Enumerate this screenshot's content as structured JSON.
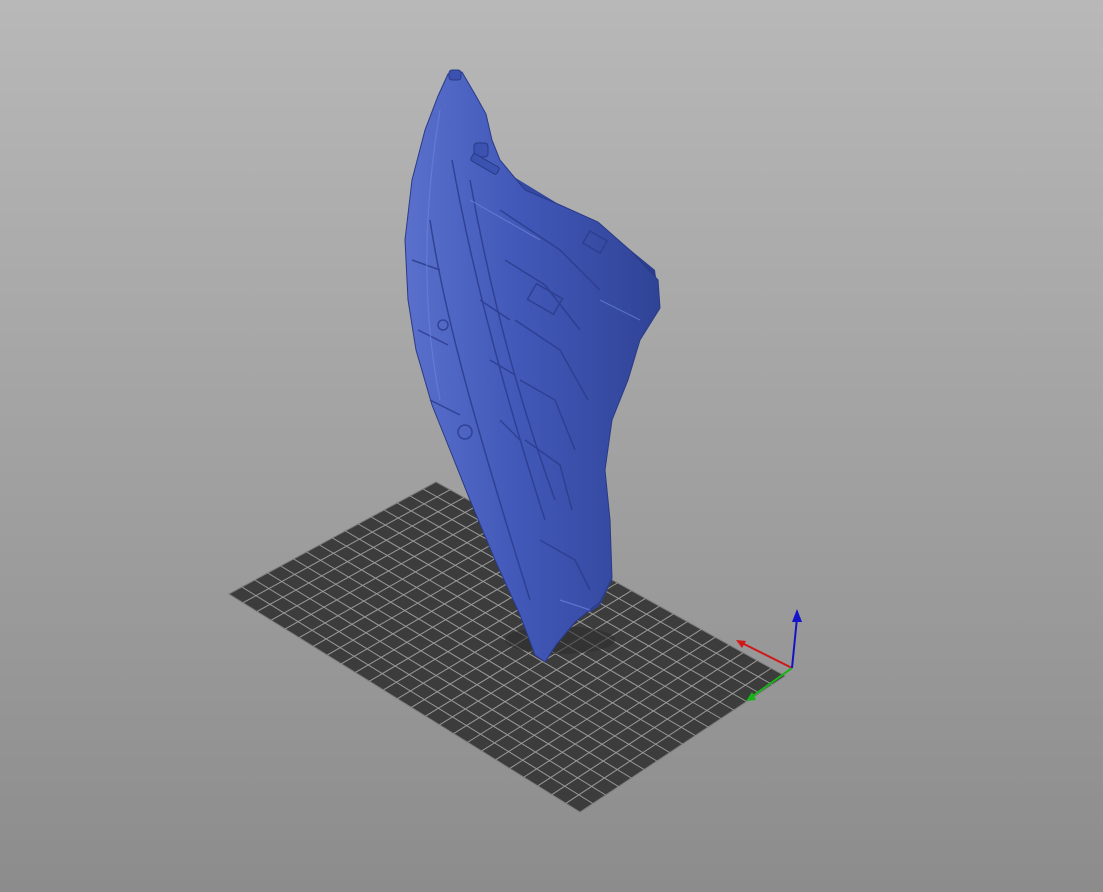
{
  "viewport": {
    "background_top": "#b8b8b8",
    "background_bottom": "#8c8c8c"
  },
  "build_plate": {
    "color": "#3c3c3c",
    "grid_line_color": "#9a9a9a",
    "grid_divisions_long": 25,
    "grid_divisions_short": 16
  },
  "model": {
    "color": "#4258b8",
    "shade_color": "#2f4396",
    "highlight_color": "#5a70cc"
  },
  "axis_gizmo": {
    "x_color": "#d01818",
    "y_color": "#18b418",
    "z_color": "#1414c8",
    "icon": "axis-gizmo-icon"
  }
}
